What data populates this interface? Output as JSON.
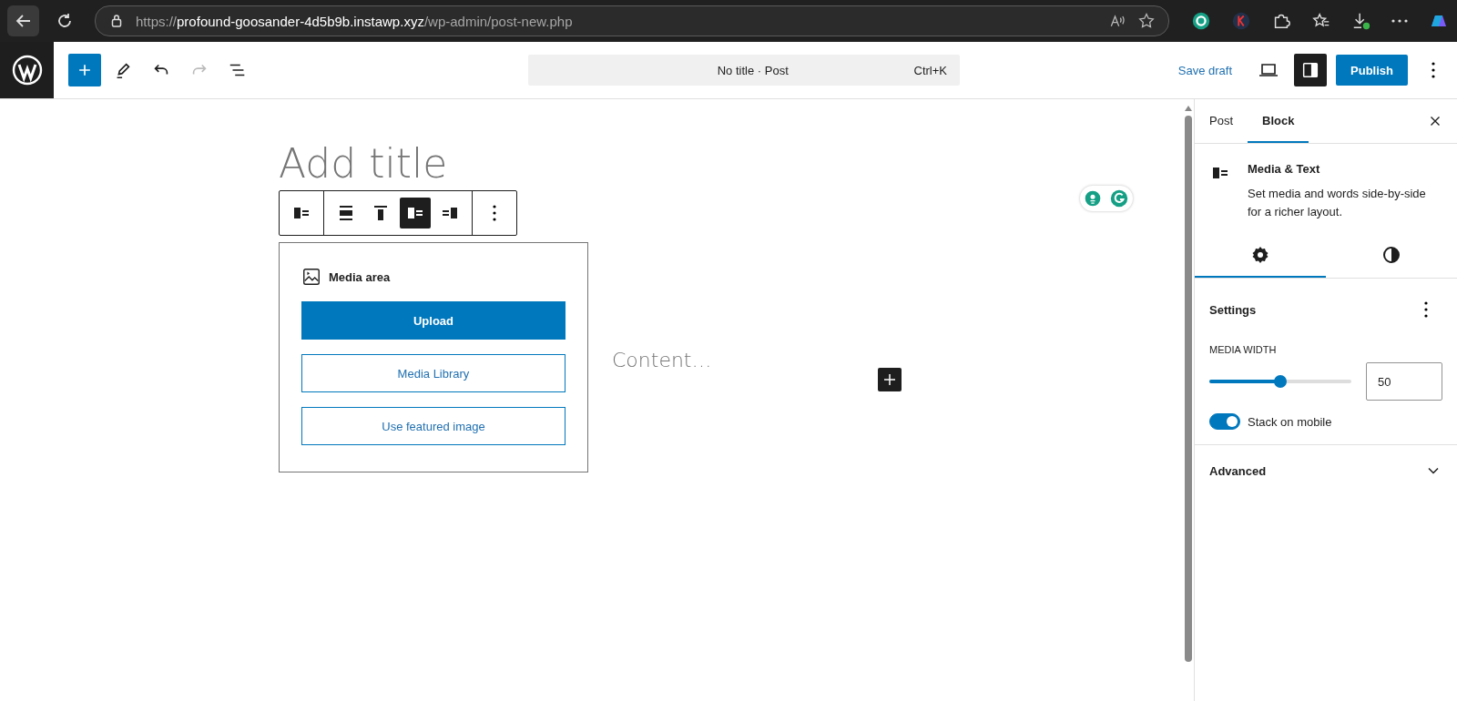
{
  "browser": {
    "url": {
      "scheme": "https://",
      "host": "profound-goosander-4d5b9b.instawp.xyz",
      "path": "/wp-admin/post-new.php"
    }
  },
  "header": {
    "undo_disabled": false,
    "redo_disabled": true,
    "command_bar": {
      "title": "No title · Post",
      "shortcut": "Ctrl+K"
    },
    "save_draft": "Save draft",
    "sidebar_toggle_pressed": true,
    "publish": "Publish"
  },
  "editor": {
    "title_placeholder": "Add title",
    "block_toolbar": [
      {
        "kind": "align-full",
        "selected": false
      },
      {
        "kind": "align-top",
        "selected": false
      },
      {
        "kind": "media-left",
        "selected": true
      },
      {
        "kind": "media-right",
        "selected": false
      }
    ],
    "media_area": {
      "label": "Media area",
      "upload": "Upload",
      "buttons": [
        "Media Library",
        "Use featured image"
      ]
    },
    "content_placeholder": "Content…"
  },
  "sidebar": {
    "tabs": [
      {
        "label": "Post",
        "selected": false
      },
      {
        "label": "Block",
        "selected": true
      }
    ],
    "block": {
      "name": "Media & Text",
      "description": "Set media and words side-by-side for a richer layout."
    },
    "panel_tabs": [
      {
        "kind": "settings",
        "selected": true
      },
      {
        "kind": "styles",
        "selected": false
      }
    ],
    "settings": {
      "title": "Settings",
      "media_width": {
        "label": "MEDIA WIDTH",
        "level": 0.5,
        "value": "50"
      },
      "stack_on_mobile": {
        "label": "Stack on mobile",
        "on": true
      }
    },
    "advanced": {
      "title": "Advanced",
      "expanded": false
    }
  }
}
